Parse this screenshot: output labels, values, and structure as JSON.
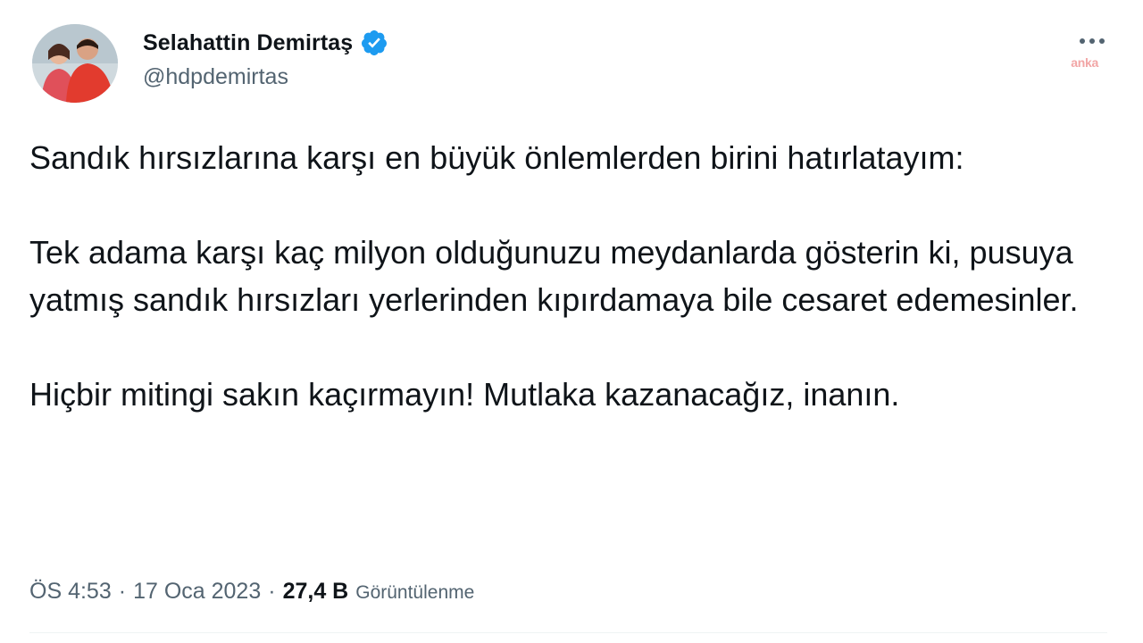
{
  "author": {
    "display_name": "Selahattin Demirtaş",
    "handle": "@hdpdemirtas",
    "verified_icon": "verified-badge-icon",
    "verified_color": "#1d9bf0"
  },
  "watermark": "anka",
  "tweet": {
    "paragraphs": [
      "Sandık hırsızlarına karşı en büyük önlemlerden birini hatırlatayım:",
      "Tek adama karşı kaç milyon olduğunuzu meydanlarda gösterin ki, pusuya yatmış sandık hırsızları yerlerinden kıpırdamaya bile cesaret edemesinler.",
      "Hiçbir mitingi sakın kaçırmayın! Mutlaka kazanacağız, inanın."
    ]
  },
  "meta": {
    "time": "ÖS 4:53",
    "separator": "·",
    "date": "17 Oca 2023",
    "views_count": "27,4 B",
    "views_label": "Görüntülenme"
  },
  "icons": {
    "more": "more-options-icon"
  }
}
